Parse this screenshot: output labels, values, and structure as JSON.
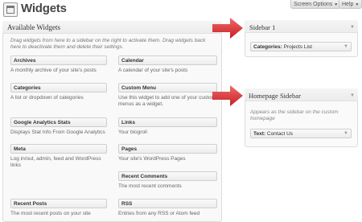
{
  "header": {
    "title": "Widgets",
    "screen_options": "Screen Options",
    "help": "Help"
  },
  "available": {
    "title": "Available Widgets",
    "description": "Drag widgets from here to a sidebar on the right to activate them. Drag widgets back here to deactivate them and delete their settings.",
    "widgets": [
      {
        "name": "Archives",
        "desc": "A monthly archive of your site's posts"
      },
      {
        "name": "Calendar",
        "desc": "A calendar of your site's posts"
      },
      {
        "name": "Categories",
        "desc": "A list or dropdown of categories"
      },
      {
        "name": "Custom Menu",
        "desc": "Use this widget to add one of your custom menus as a widget."
      },
      {
        "name": "Google Analytics Stats",
        "desc": "Displays Stat Info From Google Analytics"
      },
      {
        "name": "Links",
        "desc": "Your blogroll"
      },
      {
        "name": "Meta",
        "desc": "Log in/out, admin, feed and WordPress links"
      },
      {
        "name": "Pages",
        "desc": "Your site's WordPress Pages"
      },
      {
        "name": "Recent Comments",
        "desc": "The most recent comments"
      },
      {
        "name": "Recent Posts",
        "desc": "The most recent posts on your site"
      },
      {
        "name": "RSS",
        "desc": "Entries from any RSS or Atom feed"
      }
    ]
  },
  "sidebars": [
    {
      "title": "Sidebar 1",
      "widget_type": "Categories:",
      "widget_title": "Projects List"
    },
    {
      "title": "Homepage Sidebar",
      "description": "Appears as the sidebar on the custom homepage",
      "widget_type": "Text:",
      "widget_title": "Contact Us"
    }
  ],
  "colors": {
    "arrow": "#d9262b",
    "accent": "#464646"
  },
  "icons": {
    "logo": "widgets-icon",
    "collapse": "triangle-down-icon"
  }
}
